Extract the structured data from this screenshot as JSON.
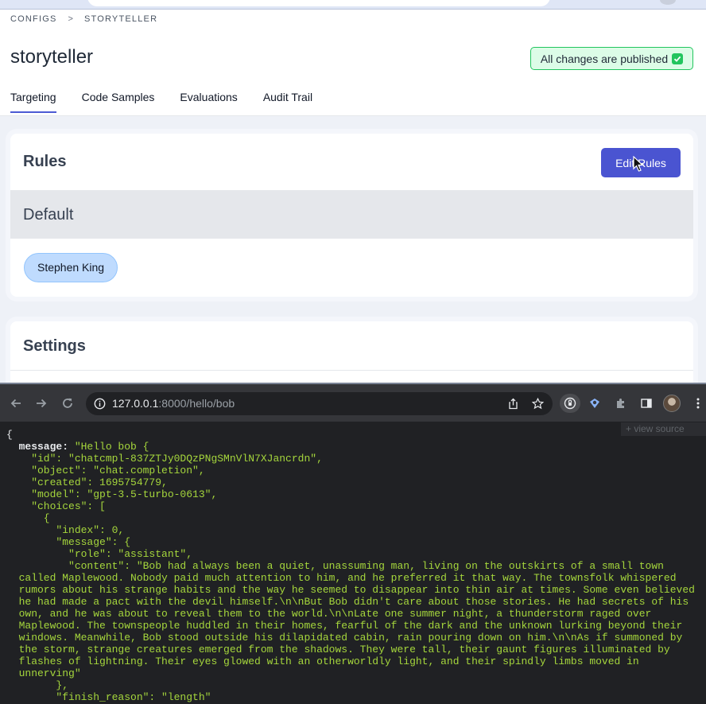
{
  "app": {
    "breadcrumb": [
      "CONFIGS",
      "STORYTELLER"
    ],
    "breadcrumb_separator": ">",
    "title": "storyteller",
    "publish_status": "All changes are published",
    "tabs": [
      {
        "label": "Targeting",
        "active": true
      },
      {
        "label": "Code Samples",
        "active": false
      },
      {
        "label": "Evaluations",
        "active": false
      },
      {
        "label": "Audit Trail",
        "active": false
      }
    ],
    "rules": {
      "title": "Rules",
      "edit_button": "Edit Rules",
      "default_label": "Default",
      "chip": "Stephen King"
    },
    "settings": {
      "title": "Settings"
    },
    "colors": {
      "accent": "#4a54d1",
      "success": "#22c55e",
      "chip_bg": "#bfdbfe"
    }
  },
  "browser": {
    "url_host": "127.0.0.1",
    "url_rest": ":8000/hello/bob",
    "view_source_label": "+ view source",
    "icons": [
      "back-icon",
      "forward-icon",
      "reload-icon",
      "info-icon",
      "share-icon",
      "bookmark-star-icon",
      "extension-icon",
      "puzzle-icon",
      "sidepanel-icon",
      "avatar",
      "kebab-menu-icon"
    ],
    "json_lines": [
      "{",
      "  message: \"Hello bob {",
      "    \"id\": \"chatcmpl-837ZTJy0DQzPNgSMnVlN7XJancrdn\",",
      "    \"object\": \"chat.completion\",",
      "    \"created\": 1695754779,",
      "    \"model\": \"gpt-3.5-turbo-0613\",",
      "    \"choices\": [",
      "      {",
      "        \"index\": 0,",
      "        \"message\": {",
      "          \"role\": \"assistant\",",
      "          \"content\": \"Bob had always been a quiet, unassuming man, living on the outskirts of a small town",
      "  called Maplewood. Nobody paid much attention to him, and he preferred it that way. The townsfolk whispered",
      "  rumors about his strange habits and the way he seemed to disappear into thin air at times. Some even believed",
      "  he had made a pact with the devil himself.\\n\\nBut Bob didn't care about those stories. He had secrets of his",
      "  own, and he was about to reveal them to the world.\\n\\nLate one summer night, a thunderstorm raged over",
      "  Maplewood. The townspeople huddled in their homes, fearful of the dark and the unknown lurking beyond their",
      "  windows. Meanwhile, Bob stood outside his dilapidated cabin, rain pouring down on him.\\n\\nAs if summoned by",
      "  the storm, strange creatures emerged from the shadows. They were tall, their gaunt figures illuminated by",
      "  flashes of lightning. Their eyes glowed with an otherworldly light, and their spindly limbs moved in",
      "  unnerving\"",
      "        },",
      "        \"finish_reason\": \"length\""
    ]
  }
}
